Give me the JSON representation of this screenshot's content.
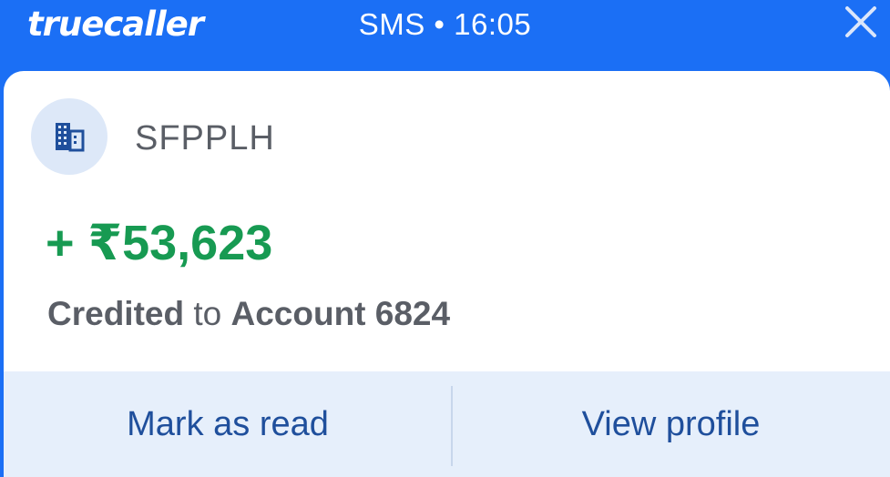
{
  "header": {
    "brand": "truecaller",
    "status": "SMS • 16:05",
    "close_icon": "close-icon"
  },
  "message": {
    "avatar_icon": "building-icon",
    "sender": "SFPPLH",
    "amount": "+ ₹53,623",
    "desc_bold1": "Credited",
    "desc_mid": " to ",
    "desc_bold2": "Account 6824"
  },
  "actions": {
    "mark_read": "Mark as read",
    "view_profile": "View profile"
  },
  "colors": {
    "brand_blue": "#1b6ff5",
    "amount_green": "#179a52",
    "action_text": "#1f4f9c",
    "action_bg": "#e6effb"
  }
}
